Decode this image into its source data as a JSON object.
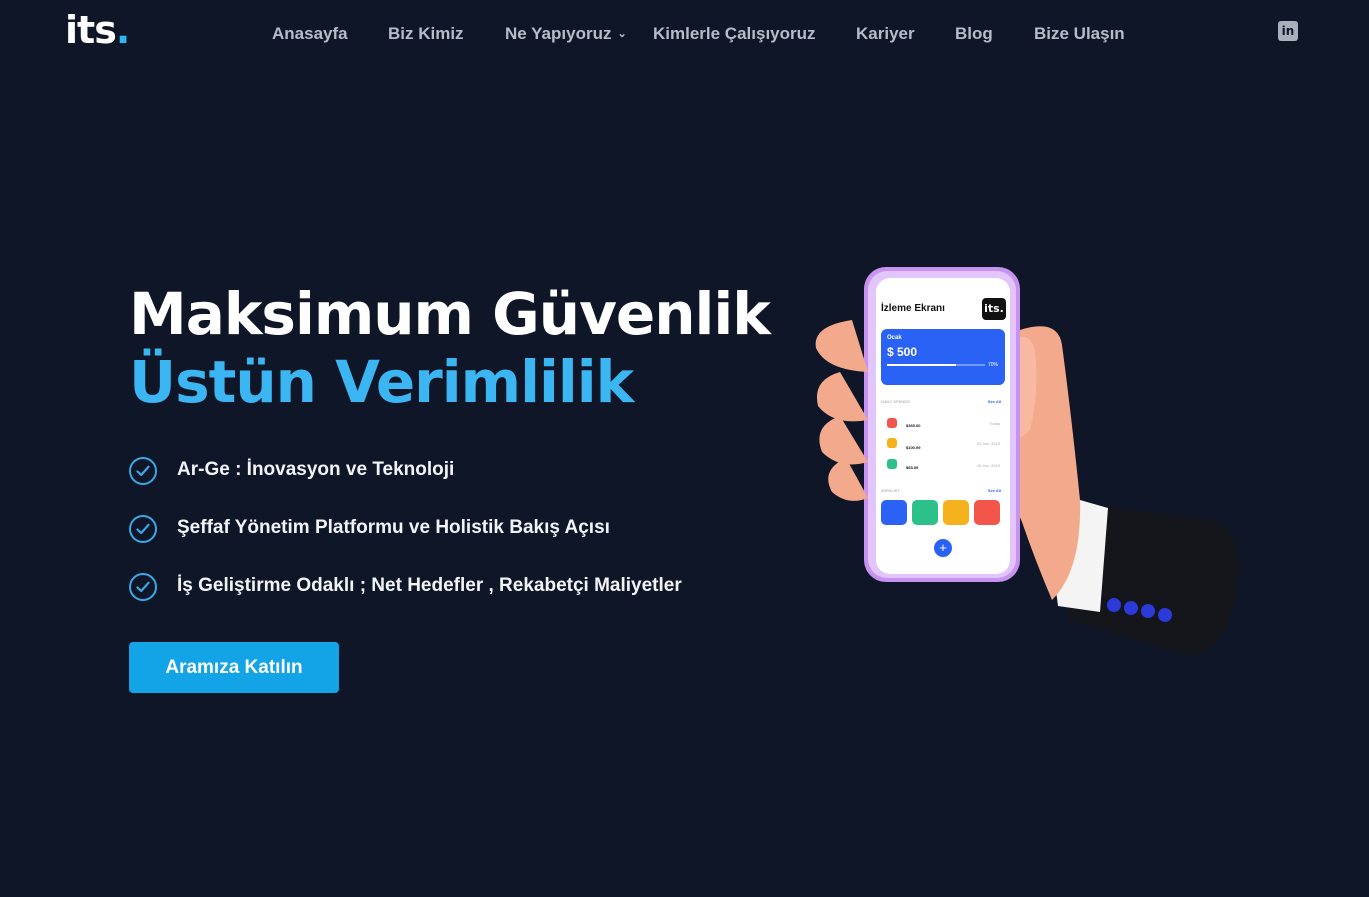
{
  "brand": {
    "logo_text": "its",
    "logo_dot": "."
  },
  "nav": {
    "items": [
      {
        "label": "Anasayfa"
      },
      {
        "label": "Biz Kimiz"
      },
      {
        "label": "Ne Yapıyoruz"
      },
      {
        "label": "Kimlerle Çalışıyoruz"
      },
      {
        "label": "Kariyer"
      },
      {
        "label": "Blog"
      },
      {
        "label": "Bize Ulaşın"
      }
    ],
    "social_label": "in"
  },
  "hero": {
    "title_line1": "Maksimum Güvenlik",
    "title_line2": "Üstün Verimlilik",
    "features": [
      {
        "text": "Ar-Ge : İnovasyon ve Teknoloji"
      },
      {
        "text": "Şeffaf Yönetim Platformu ve Holistik Bakış Açısı"
      },
      {
        "text": "İş Geliştirme Odaklı ; Net Hedefler , Rekabetçi Maliyetler"
      }
    ],
    "cta_label": "Aramıza Katılın"
  },
  "phone": {
    "screen_title": "İzleme Ekranı",
    "badge": "its.",
    "card_month": "Ocak",
    "card_amount": "$ 500",
    "card_percent": "70%",
    "card_progress": 0.7,
    "section1_label": "DAILY SPENDS",
    "section1_see": "See All",
    "transactions": [
      {
        "amount": "$365.00",
        "date": "Today"
      },
      {
        "amount": "$100.99",
        "date": "20 Jan, 2019"
      },
      {
        "amount": "$65.00",
        "date": "15 Jan, 2019"
      }
    ],
    "section2_label": "WISHLIST",
    "section2_see": "See All",
    "fab": "+"
  },
  "colors": {
    "background": "#0f1627",
    "accent": "#3bb6f3",
    "button": "#12a4e6",
    "nav_text": "#b6bcc8",
    "phone_frame": "#c792f0",
    "screen_card": "#2a62f5"
  }
}
